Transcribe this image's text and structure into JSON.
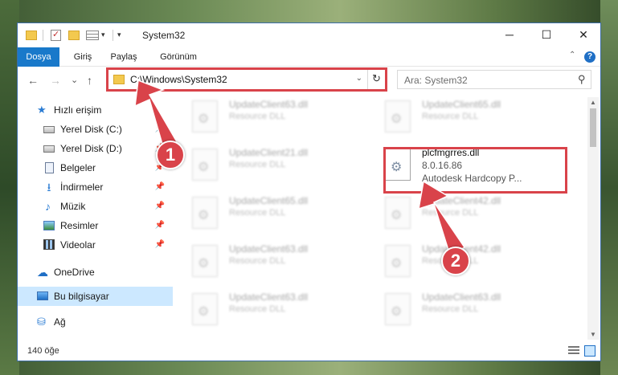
{
  "window": {
    "title": "System32",
    "controls": {
      "minimize": "─",
      "maximize": "☐",
      "close": "✕"
    }
  },
  "ribbon": {
    "tabs": [
      "Dosya",
      "Giriş",
      "Paylaş",
      "Görünüm"
    ],
    "collapse_glyph": "⌃",
    "help_glyph": "?"
  },
  "nav": {
    "back_glyph": "←",
    "forward_glyph": "→",
    "recent_glyph": "⌄",
    "up_glyph": "↑",
    "address": "C:\\Windows\\System32",
    "dropdown_glyph": "⌄",
    "refresh_glyph": "↻",
    "search_placeholder": "Ara: System32",
    "search_glyph": "⚲"
  },
  "sidebar": {
    "items": [
      {
        "label": "Hızlı erişim",
        "icon": "star-icon",
        "glyph": "★",
        "pinned": false
      },
      {
        "label": "Yerel Disk (C:)",
        "icon": "drive-icon",
        "pinned": true
      },
      {
        "label": "Yerel Disk (D:)",
        "icon": "drive-icon",
        "pinned": true
      },
      {
        "label": "Belgeler",
        "icon": "documents-icon",
        "pinned": true
      },
      {
        "label": "İndirmeler",
        "icon": "downloads-icon",
        "glyph": "⭳",
        "pinned": true
      },
      {
        "label": "Müzik",
        "icon": "music-icon",
        "glyph": "♪",
        "pinned": true
      },
      {
        "label": "Resimler",
        "icon": "pictures-icon",
        "pinned": true
      },
      {
        "label": "Videolar",
        "icon": "videos-icon",
        "pinned": true
      },
      {
        "label": "OneDrive",
        "icon": "cloud-icon",
        "glyph": "☁",
        "pinned": false
      },
      {
        "label": "Bu bilgisayar",
        "icon": "computer-icon",
        "pinned": false,
        "selected": true
      },
      {
        "label": "Ağ",
        "icon": "network-icon",
        "glyph": "⛁",
        "pinned": false
      }
    ],
    "pin_glyph": "📌"
  },
  "files": [
    {
      "name": "UpdateClient63.dll",
      "desc": "Resource DLL",
      "selected": false
    },
    {
      "name": "UpdateClient65.dll",
      "desc": "Resource DLL",
      "selected": false
    },
    {
      "name": "UpdateClient21.dll",
      "desc": "Resource DLL",
      "selected": false
    },
    {
      "name": "plcfmgrres.dll",
      "desc": "8.0.16.86",
      "desc2": "Autodesk Hardcopy P...",
      "selected": true
    },
    {
      "name": "UpdateClient65.dll",
      "desc": "Resource DLL",
      "selected": false
    },
    {
      "name": "UpdateClient42.dll",
      "desc": "Resource DLL",
      "selected": false
    },
    {
      "name": "UpdateClient63.dll",
      "desc": "Resource DLL",
      "selected": false
    },
    {
      "name": "UpdateClient42.dll",
      "desc": "Resource DLL",
      "selected": false
    },
    {
      "name": "UpdateClient63.dll",
      "desc": "Resource DLL",
      "selected": false
    },
    {
      "name": "UpdateClient63.dll",
      "desc": "Resource DLL",
      "selected": false
    }
  ],
  "status": {
    "item_count": "140 öğe"
  },
  "callouts": [
    {
      "number": "1"
    },
    {
      "number": "2"
    }
  ],
  "colors": {
    "accent": "#1979ca",
    "highlight": "#d9434a",
    "selection": "#cce8ff"
  }
}
